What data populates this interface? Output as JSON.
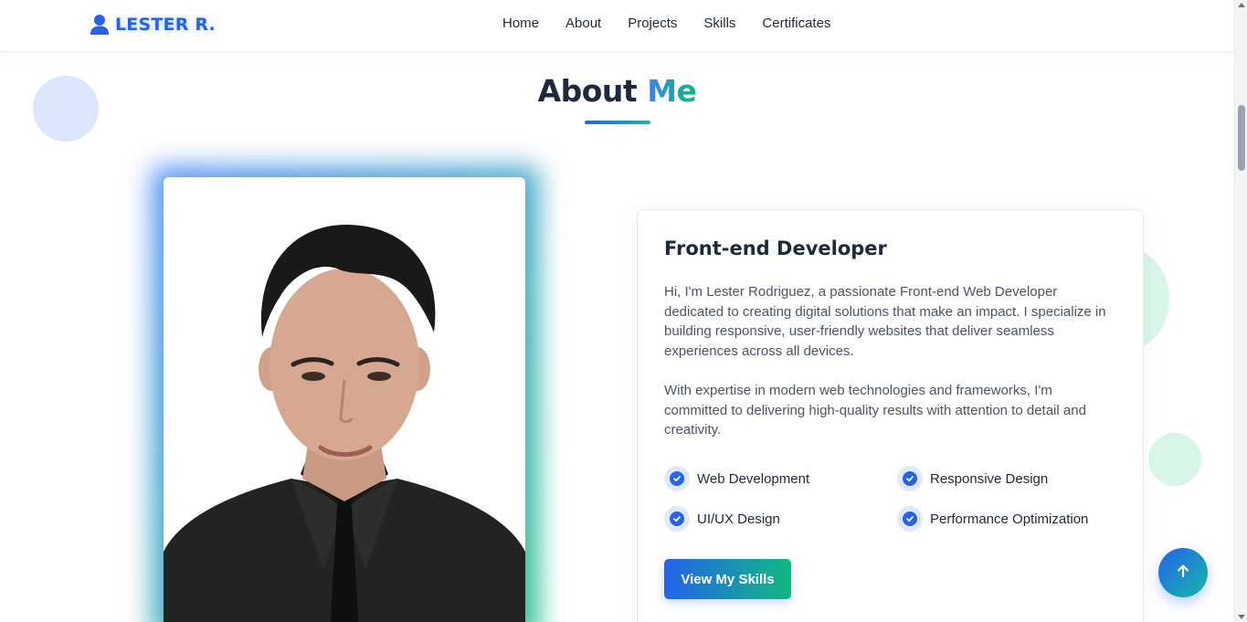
{
  "brand": {
    "name": "LESTER R.",
    "icon": "user-icon"
  },
  "nav": {
    "items": [
      {
        "label": "Home"
      },
      {
        "label": "About"
      },
      {
        "label": "Projects"
      },
      {
        "label": "Skills"
      },
      {
        "label": "Certificates"
      }
    ]
  },
  "about": {
    "title_main": "About",
    "title_accent": "Me",
    "photo_alt": "Portrait of Lester Rodriguez"
  },
  "card": {
    "title": "Front-end Developer",
    "paragraph_1": "Hi, I'm Lester Rodriguez, a passionate Front-end Web Developer dedicated to creating digital solutions that make an impact. I specialize in building responsive, user-friendly websites that deliver seamless experiences across all devices.",
    "paragraph_2": "With expertise in modern web technologies and frameworks, I'm committed to delivering high-quality results with attention to detail and creativity.",
    "features": [
      {
        "label": "Web Development",
        "icon": "check-circle-icon"
      },
      {
        "label": "Responsive Design",
        "icon": "check-circle-icon"
      },
      {
        "label": "UI/UX Design",
        "icon": "check-circle-icon"
      },
      {
        "label": "Performance Optimization",
        "icon": "check-circle-icon"
      }
    ],
    "button_label": "View My Skills"
  },
  "back_to_top": {
    "icon": "arrow-up-icon"
  },
  "colors": {
    "primary": "#2563eb",
    "accent": "#10b981",
    "heading": "#1e293b",
    "body_text": "#4b5563"
  }
}
